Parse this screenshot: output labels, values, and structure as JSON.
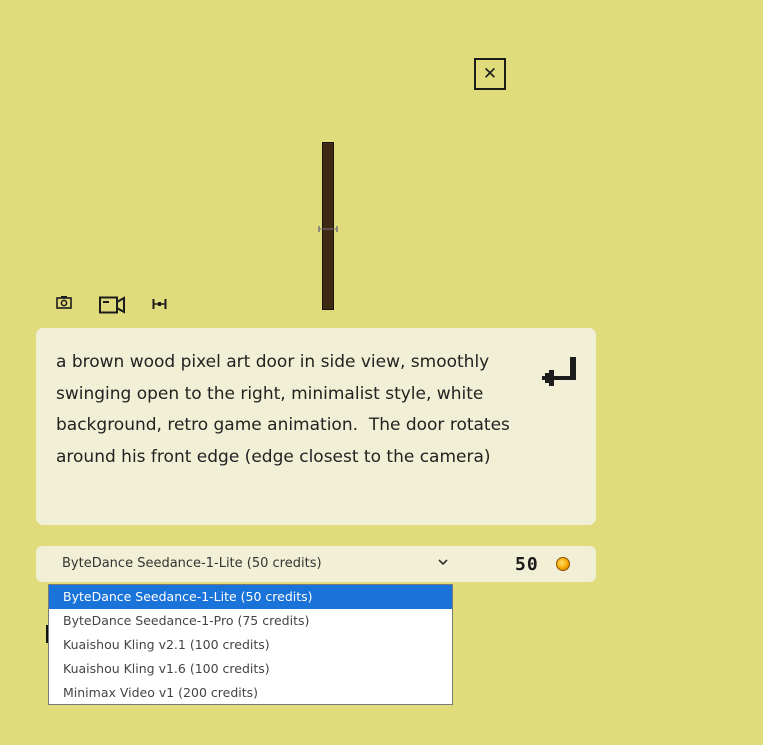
{
  "prompt": {
    "text": "a brown wood pixel art door in side view, smoothly swinging open to the right, minimalist style, white background, retro game animation.  The door rotates around his front edge (edge closest to the camera)"
  },
  "model": {
    "selected": "ByteDance Seedance-1-Lite (50 credits)",
    "options": [
      "ByteDance Seedance-1-Lite (50 credits)",
      "ByteDance Seedance-1-Pro (75 credits)",
      "Kuaishou Kling v2.1 (100 credits)",
      "Kuaishou Kling v1.6 (100 credits)",
      "Minimax Video v1 (200 credits)"
    ],
    "selected_index": 0
  },
  "credits": {
    "value": "50"
  },
  "icons": {
    "close": "close-icon",
    "photo": "camera-icon",
    "video": "video-camera-icon",
    "resize": "resize-icon",
    "submit": "enter-icon",
    "chevron": "chevron-down-icon",
    "coin": "coin-icon"
  },
  "colors": {
    "background": "#e0dc7b",
    "panel": "#f1efd5",
    "door": "#3e2a14",
    "selected_option": "#1a73d9"
  }
}
